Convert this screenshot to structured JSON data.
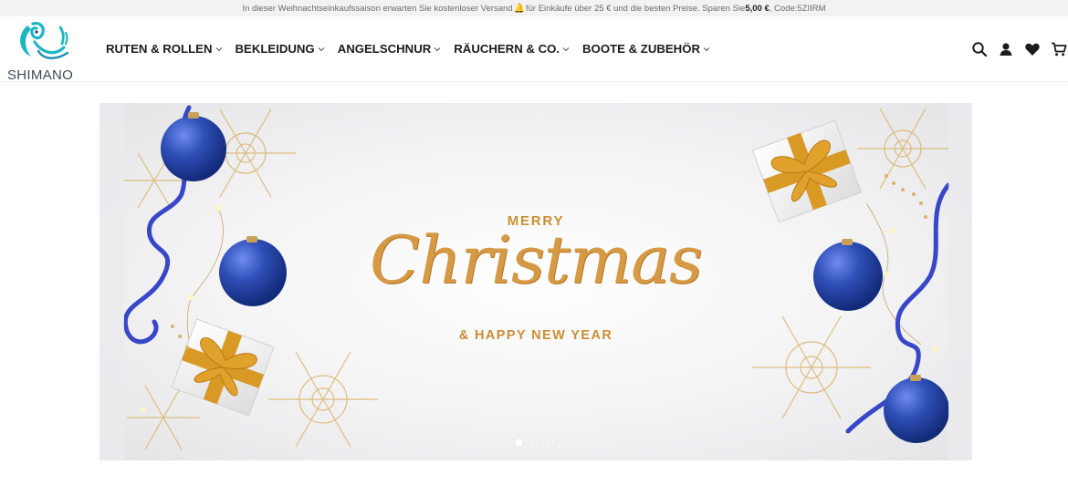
{
  "promo": {
    "text_before": "In dieser Weihnachtseinkaufssaison erwarten Sie kostenloser Versand",
    "text_after": " für Einkäufe über 25 € und die besten Preise. Sparen Sie ",
    "amount": "5,00 €",
    "code": ", Code:5ZIIRM"
  },
  "brand": {
    "name": "SHIMANO",
    "colors": {
      "teal": "#1bb6c3",
      "navy": "#1d3a6b"
    }
  },
  "nav": {
    "items": [
      {
        "label": "RUTEN & ROLLEN"
      },
      {
        "label": "BEKLEIDUNG"
      },
      {
        "label": "ANGELSCHNUR"
      },
      {
        "label": "RÄUCHERN & CO."
      },
      {
        "label": "BOOTE & ZUBEHÖR"
      }
    ]
  },
  "header_icons": [
    "search-icon",
    "account-icon",
    "wishlist-icon",
    "cart-icon"
  ],
  "banner": {
    "merry": "MERRY",
    "christmas": "Christmas",
    "new_year": "& HAPPY NEW YEAR",
    "slides_total": 3,
    "active_slide": 1,
    "colors": {
      "gold": "#d69a45",
      "blue": "#2f4fb8",
      "ribbon": "#3847c8"
    }
  }
}
